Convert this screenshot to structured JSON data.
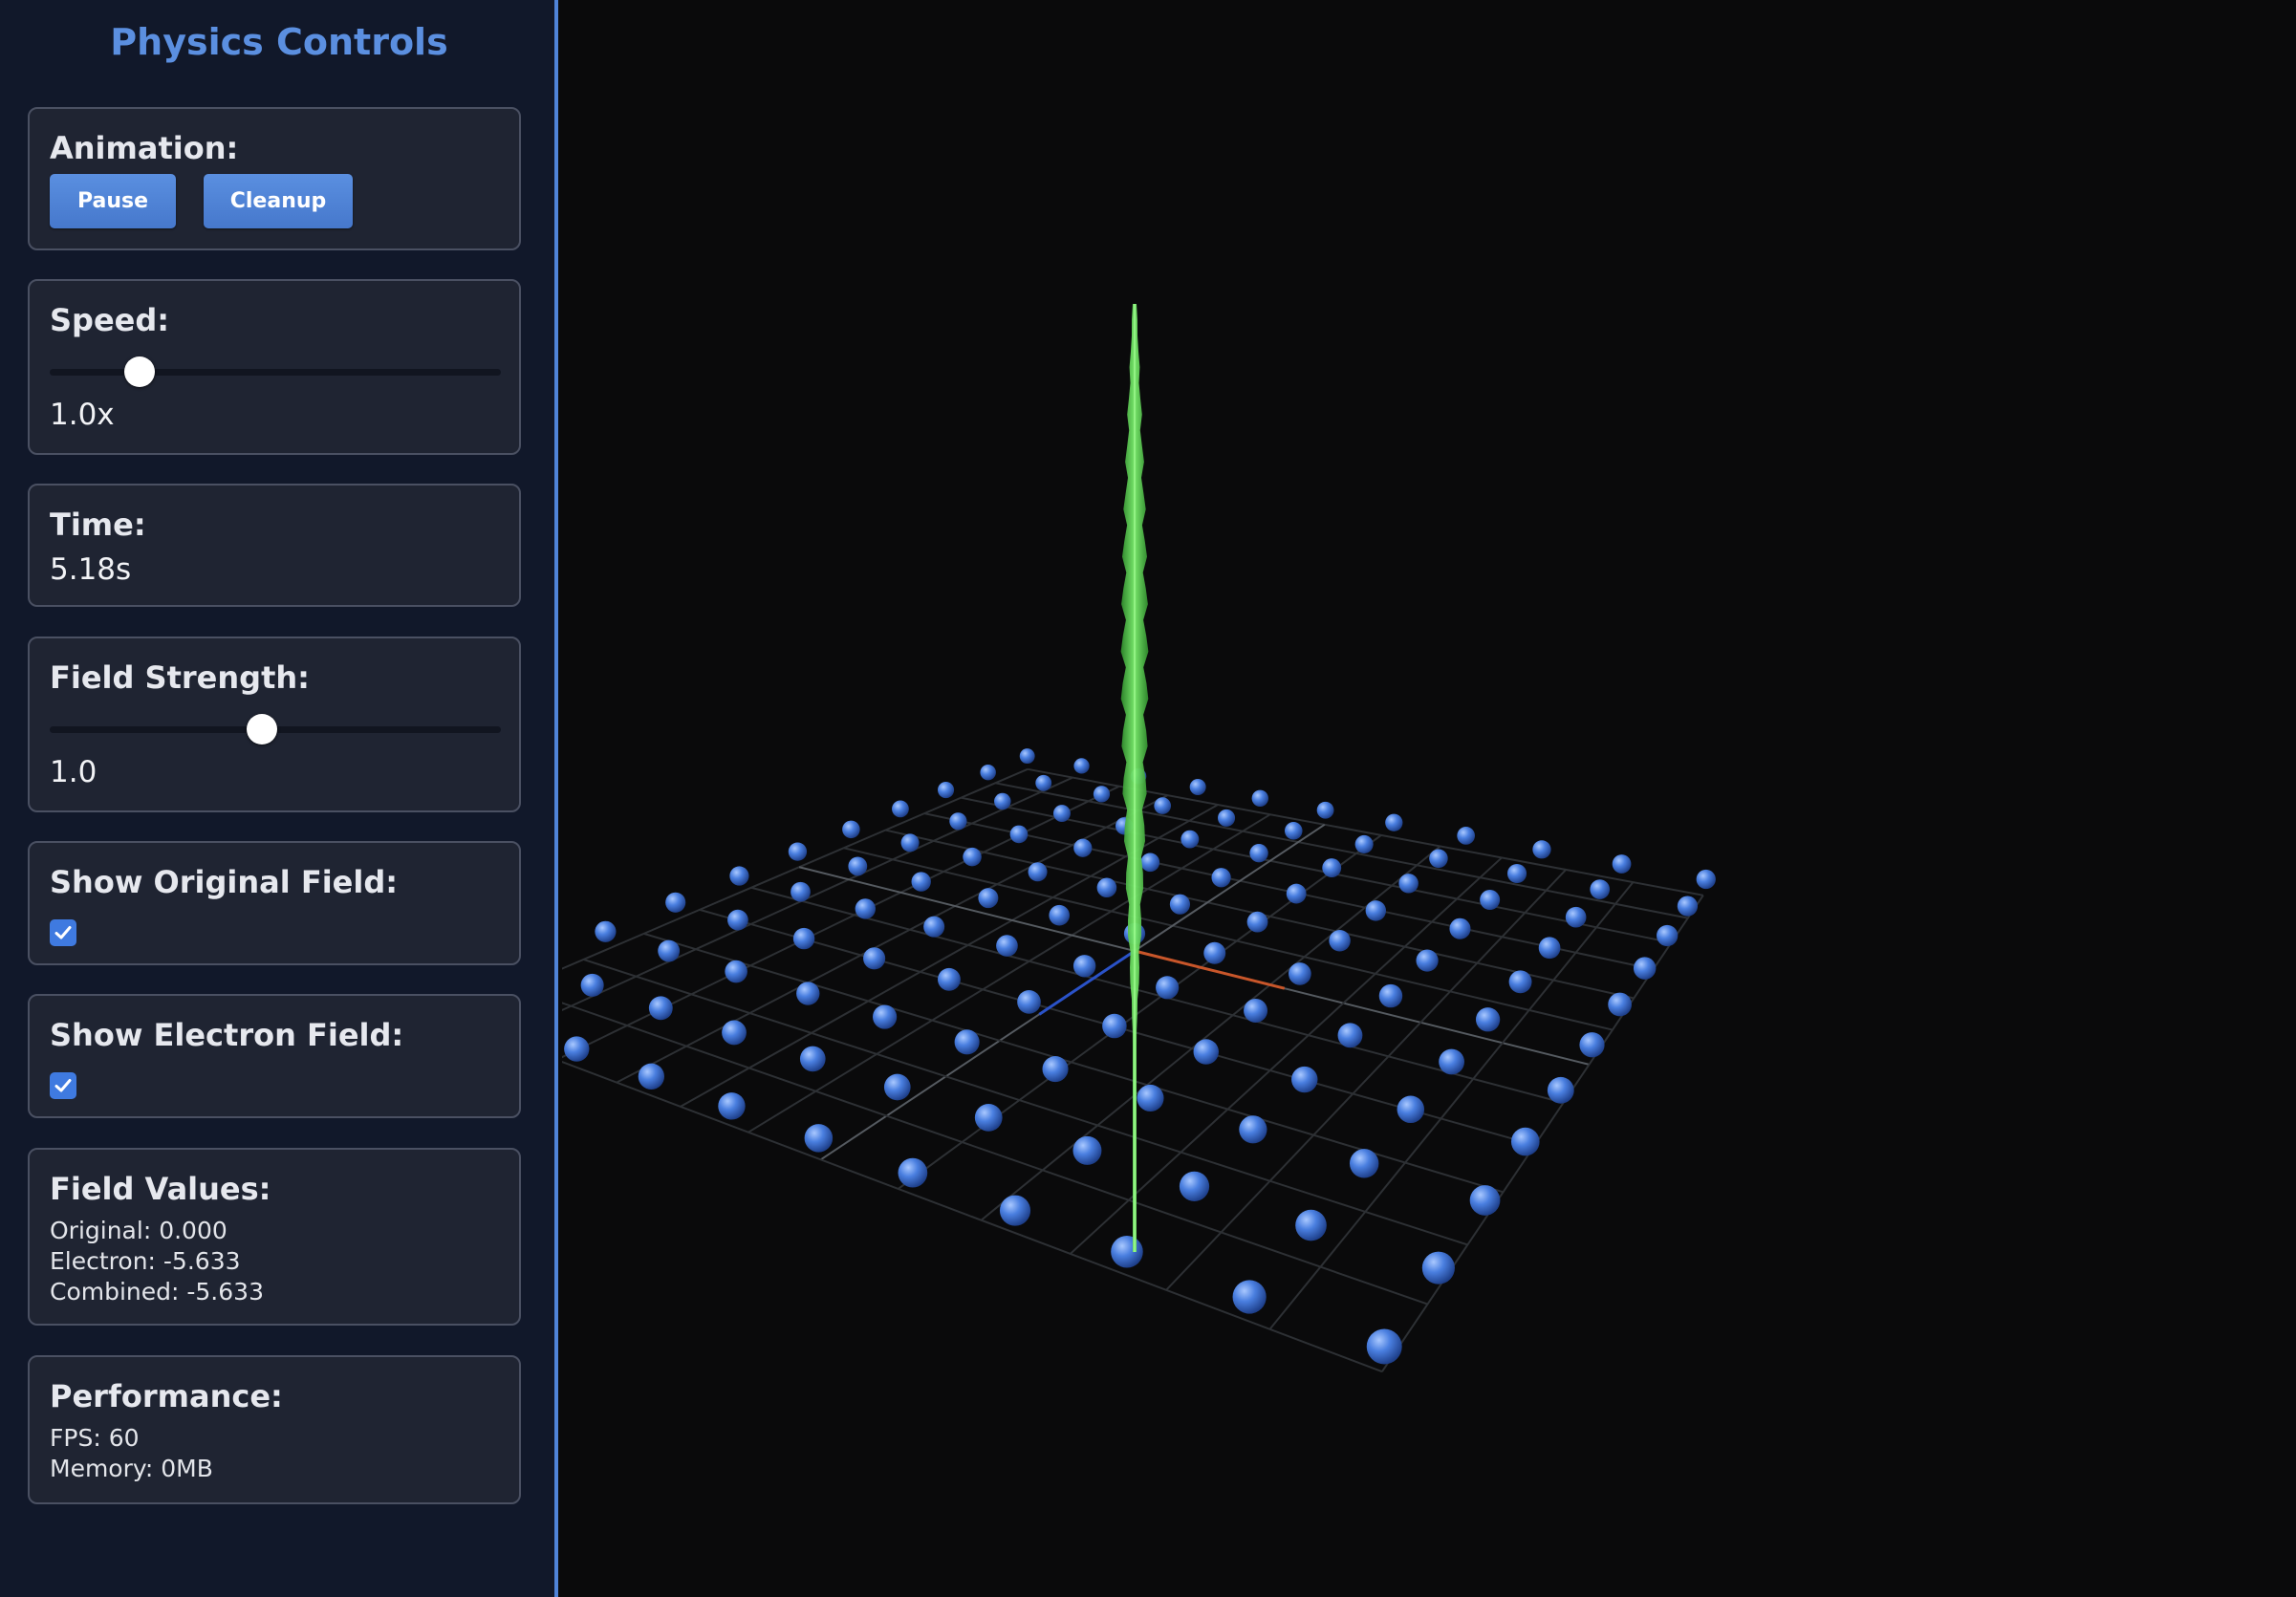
{
  "sidebar": {
    "title": "Physics Controls",
    "animation": {
      "label": "Animation:",
      "pause_label": "Pause",
      "cleanup_label": "Cleanup"
    },
    "speed": {
      "label": "Speed:",
      "value_text": "1.0x",
      "slider_fraction": 0.2
    },
    "time": {
      "label": "Time:",
      "value_text": "5.18s"
    },
    "field_strength": {
      "label": "Field Strength:",
      "value_text": "1.0",
      "slider_fraction": 0.47
    },
    "show_original": {
      "label": "Show Original Field:",
      "checked": true
    },
    "show_electron": {
      "label": "Show Electron Field:",
      "checked": true
    },
    "field_values": {
      "label": "Field Values:",
      "original": "Original: 0.000",
      "electron": "Electron: -5.633",
      "combined": "Combined: -5.633"
    },
    "performance": {
      "label": "Performance:",
      "fps": "FPS: 60",
      "memory": "Memory: 0MB"
    }
  },
  "colors": {
    "accent": "#5b8fe0",
    "button": "#4f83d8",
    "panel_bg": "#1f2432",
    "sidebar_bg": "#11182a",
    "viewport_bg": "#0a0a0b",
    "particle": "#4a7fe0",
    "field_spike": "#5fd95a",
    "axis_x": "#c8562a",
    "axis_z": "#2a52c8"
  },
  "icons": {
    "checkbox": "check-icon"
  }
}
